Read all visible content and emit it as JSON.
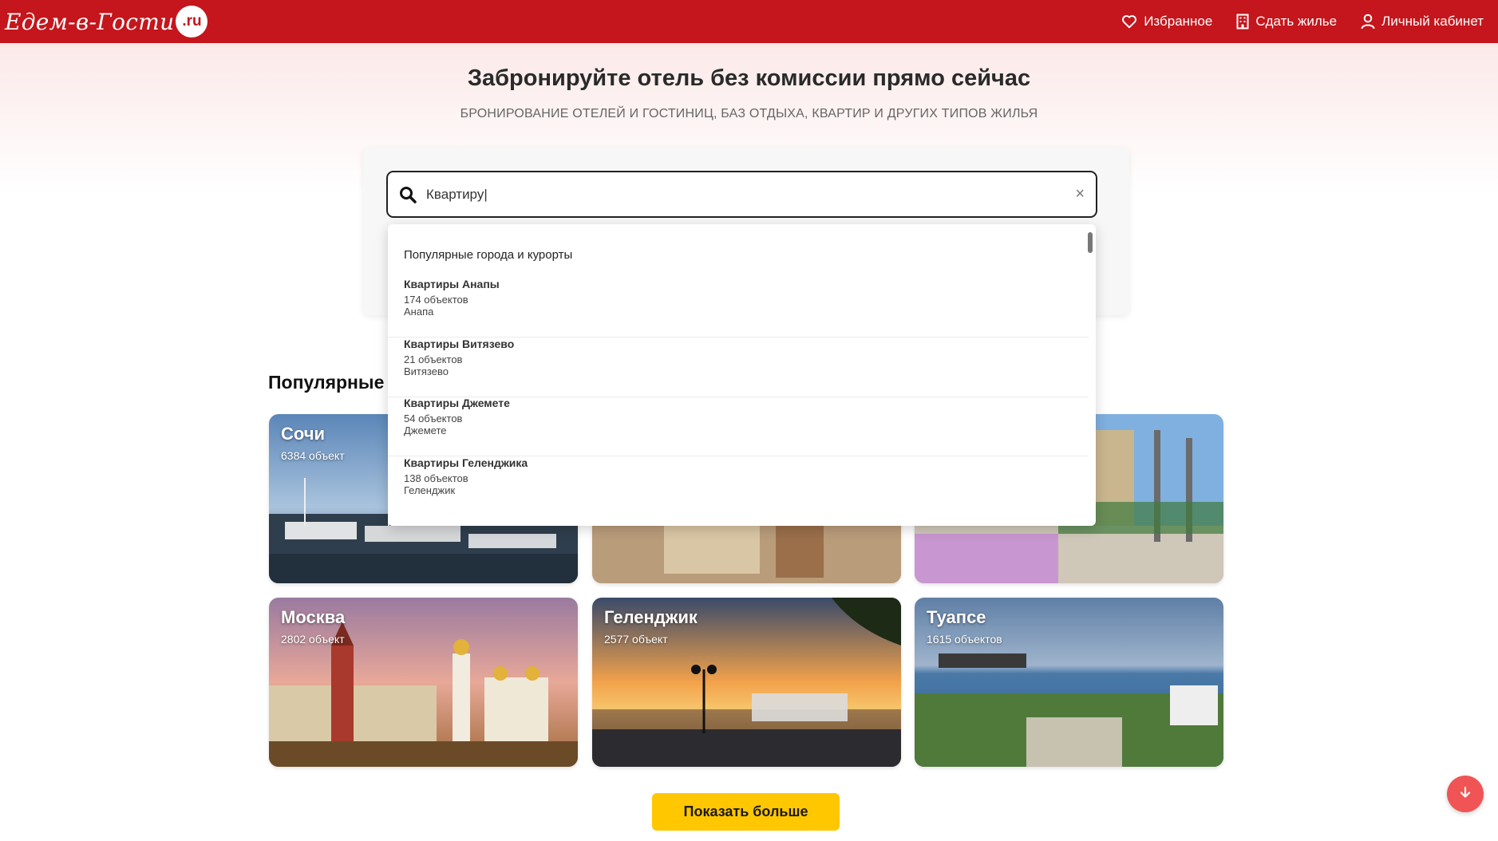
{
  "header": {
    "logo_text": "Едем-в-Гости",
    "logo_badge": ".ru",
    "nav": [
      {
        "label": "Избранное",
        "icon": "heart-icon"
      },
      {
        "label": "Сдать жилье",
        "icon": "building-icon"
      },
      {
        "label": "Личный кабинет",
        "icon": "user-icon"
      }
    ]
  },
  "hero": {
    "title": "Забронируйте отель без комиссии прямо сейчас",
    "subtitle": "БРОНИРОВАНИЕ ОТЕЛЕЙ И ГОСТИНИЦ, БАЗ ОТДЫХА, КВАРТИР И ДРУГИХ ТИПОВ ЖИЛЬЯ"
  },
  "search": {
    "value": "Квартиру|",
    "clear_label": "×"
  },
  "dropdown": {
    "heading": "Популярные города и курорты",
    "items": [
      {
        "title": "Квартиры Анапы",
        "count": "174 объектов",
        "sub": "Анапа"
      },
      {
        "title": "Квартиры Витязево",
        "count": "21 объектов",
        "sub": "Витязево"
      },
      {
        "title": "Квартиры Джемете",
        "count": "54 объектов",
        "sub": "Джемете"
      },
      {
        "title": "Квартиры Геленджика",
        "count": "138 объектов",
        "sub": "Геленджик"
      }
    ]
  },
  "popular": {
    "title": "Популярные",
    "cards": [
      {
        "name": "Сочи",
        "count": "6384 объект"
      },
      {
        "name": "",
        "count": ""
      },
      {
        "name": "",
        "count": ""
      },
      {
        "name": "Москва",
        "count": "2802 объект"
      },
      {
        "name": "Геленджик",
        "count": "2577 объект"
      },
      {
        "name": "Туапсе",
        "count": "1615 объектов"
      }
    ]
  },
  "actions": {
    "show_more": "Показать больше"
  },
  "colors": {
    "brand_red": "#c4161c",
    "accent_yellow": "#ffc700",
    "fab_red": "#f05454"
  }
}
